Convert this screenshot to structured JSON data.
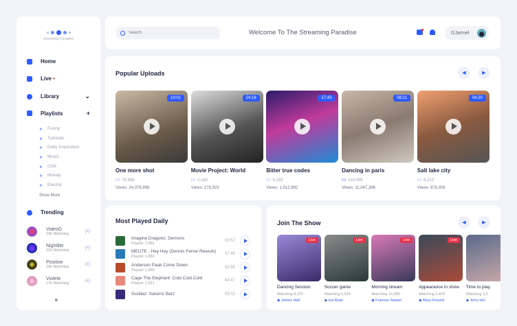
{
  "sidebar": {
    "logo_text": "Streaming Paradise",
    "nav": [
      {
        "label": "Home"
      },
      {
        "label": "Live",
        "badge": "•"
      },
      {
        "label": "Library",
        "action": "⌄"
      },
      {
        "label": "Playlists",
        "action": "+"
      }
    ],
    "playlists": [
      "Funny",
      "Tutorials",
      "Daily Inspiration",
      "Music",
      "Chill",
      "Moody",
      "Electric"
    ],
    "show_more": "Show More",
    "trending_label": "Trending",
    "trending": [
      {
        "name": "VideoG",
        "watching": "24k Watching"
      },
      {
        "name": "Nightlite",
        "watching": "21k Watching"
      },
      {
        "name": "Positive",
        "watching": "20k Watching"
      },
      {
        "name": "Violete",
        "watching": "17k Watching"
      }
    ],
    "expand": "»"
  },
  "header": {
    "search_placeholder": "Search",
    "welcome": "Welcome To The Streaming Paradise",
    "user": "GJarmel"
  },
  "popular": {
    "title": "Popular Uploads",
    "videos": [
      {
        "title": "One more shot",
        "duration": "10:01",
        "likes": "78,998",
        "views": "Views:  24,078,998"
      },
      {
        "title": "Movie Project: World",
        "duration": "24:16",
        "likes": "2,180",
        "views": "Views:  178,923"
      },
      {
        "title": "Bitter true codes",
        "duration": "17:43",
        "likes": "9,292",
        "views": "Views:  1,012,992"
      },
      {
        "title": "Dancing in paris",
        "duration": "08:21",
        "likes": "110,005",
        "views": "Views:  11,047,396"
      },
      {
        "title": "Salt lake city",
        "duration": "04:20",
        "likes": "6,223",
        "views": "Views:  878,926"
      }
    ]
  },
  "most_played": {
    "title": "Most Played Daily",
    "tracks": [
      {
        "title": "Imagine Dragons: Demons",
        "played": "Played:  2,065",
        "duration": "03:57"
      },
      {
        "title": "MEUTE - Hey Hey (Dennis Ferrer Rework)",
        "played": "Played:  1,892",
        "duration": "07:44"
      },
      {
        "title": "Anderson Paak Come Down",
        "played": "Played:  1,856",
        "duration": "02:55"
      },
      {
        "title": "Cage The Elephant: Cold Cold Cold",
        "played": "Played:  1,521",
        "duration": "04:47"
      },
      {
        "title": "Gorillaz: Saturnz Barz",
        "played": "",
        "duration": "05:02"
      }
    ]
  },
  "join": {
    "title": "Join The Show",
    "live_label": "Live",
    "shows": [
      {
        "title": "Dancing Session",
        "watching": "Watching  8,137",
        "host": "James Hall"
      },
      {
        "title": "Soccer game",
        "watching": "Watching  5,524",
        "host": "Iva Ryan"
      },
      {
        "title": "Morning stream",
        "watching": "Watching  12,988",
        "host": "Frances Swann"
      },
      {
        "title": "Appearance in show",
        "watching": "Watching  2,429",
        "host": "Mary Freund"
      },
      {
        "title": "Time to play",
        "watching": "Watching  3,0",
        "host": "Jerry Hel"
      }
    ]
  },
  "colors": {
    "accent": "#2f5bff",
    "live": "#e8334a",
    "bg": "#f1f3f9"
  }
}
